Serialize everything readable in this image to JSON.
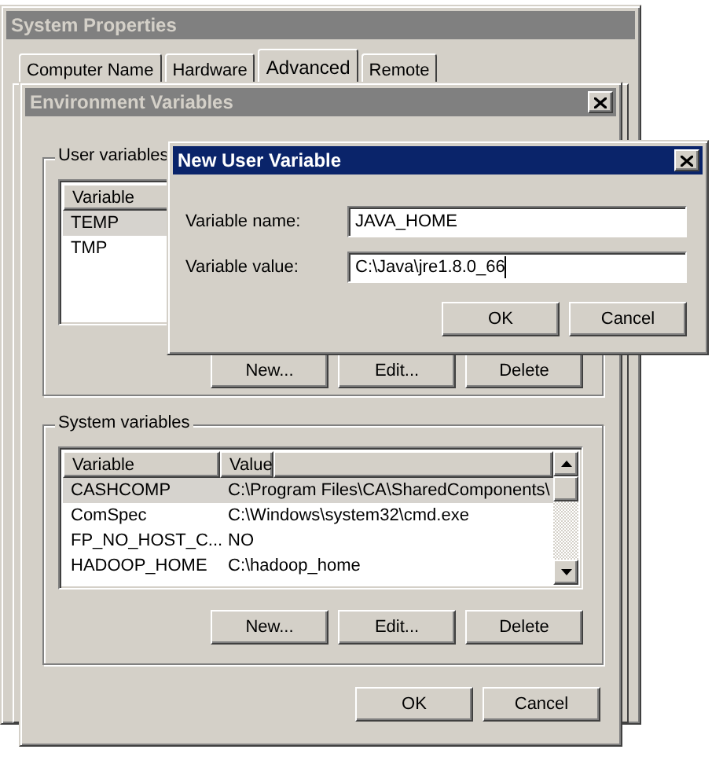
{
  "system_properties": {
    "title": "System Properties",
    "active": false,
    "tabs": [
      {
        "label": "Computer Name",
        "selected": false
      },
      {
        "label": "Hardware",
        "selected": false
      },
      {
        "label": "Advanced",
        "selected": true
      },
      {
        "label": "Remote",
        "selected": false
      }
    ]
  },
  "environment_variables": {
    "title": "Environment Variables",
    "active": false,
    "user_variables": {
      "label": "User variables",
      "columns": [
        "Variable"
      ],
      "rows": [
        {
          "cells": [
            "TEMP"
          ],
          "selected": true
        },
        {
          "cells": [
            "TMP"
          ],
          "selected": false
        }
      ],
      "buttons": [
        "New...",
        "Edit...",
        "Delete"
      ]
    },
    "system_variables": {
      "label": "System variables",
      "columns": [
        "Variable",
        "Value"
      ],
      "rows": [
        {
          "cells": [
            "CASHCOMP",
            "C:\\Program Files\\CA\\SharedComponents\\"
          ],
          "selected": true
        },
        {
          "cells": [
            "ComSpec",
            "C:\\Windows\\system32\\cmd.exe"
          ],
          "selected": false
        },
        {
          "cells": [
            "FP_NO_HOST_C...",
            "NO"
          ],
          "selected": false
        },
        {
          "cells": [
            "HADOOP_HOME",
            "C:\\hadoop_home"
          ],
          "selected": false
        }
      ],
      "buttons": [
        "New...",
        "Edit...",
        "Delete"
      ]
    },
    "buttons": [
      "OK",
      "Cancel"
    ]
  },
  "new_user_variable": {
    "title": "New User Variable",
    "active": true,
    "fields": [
      {
        "label": "Variable name:",
        "value": "JAVA_HOME",
        "focused": false
      },
      {
        "label": "Variable value:",
        "value": "C:\\Java\\jre1.8.0_66",
        "focused": true
      }
    ],
    "buttons": [
      "OK",
      "Cancel"
    ]
  }
}
